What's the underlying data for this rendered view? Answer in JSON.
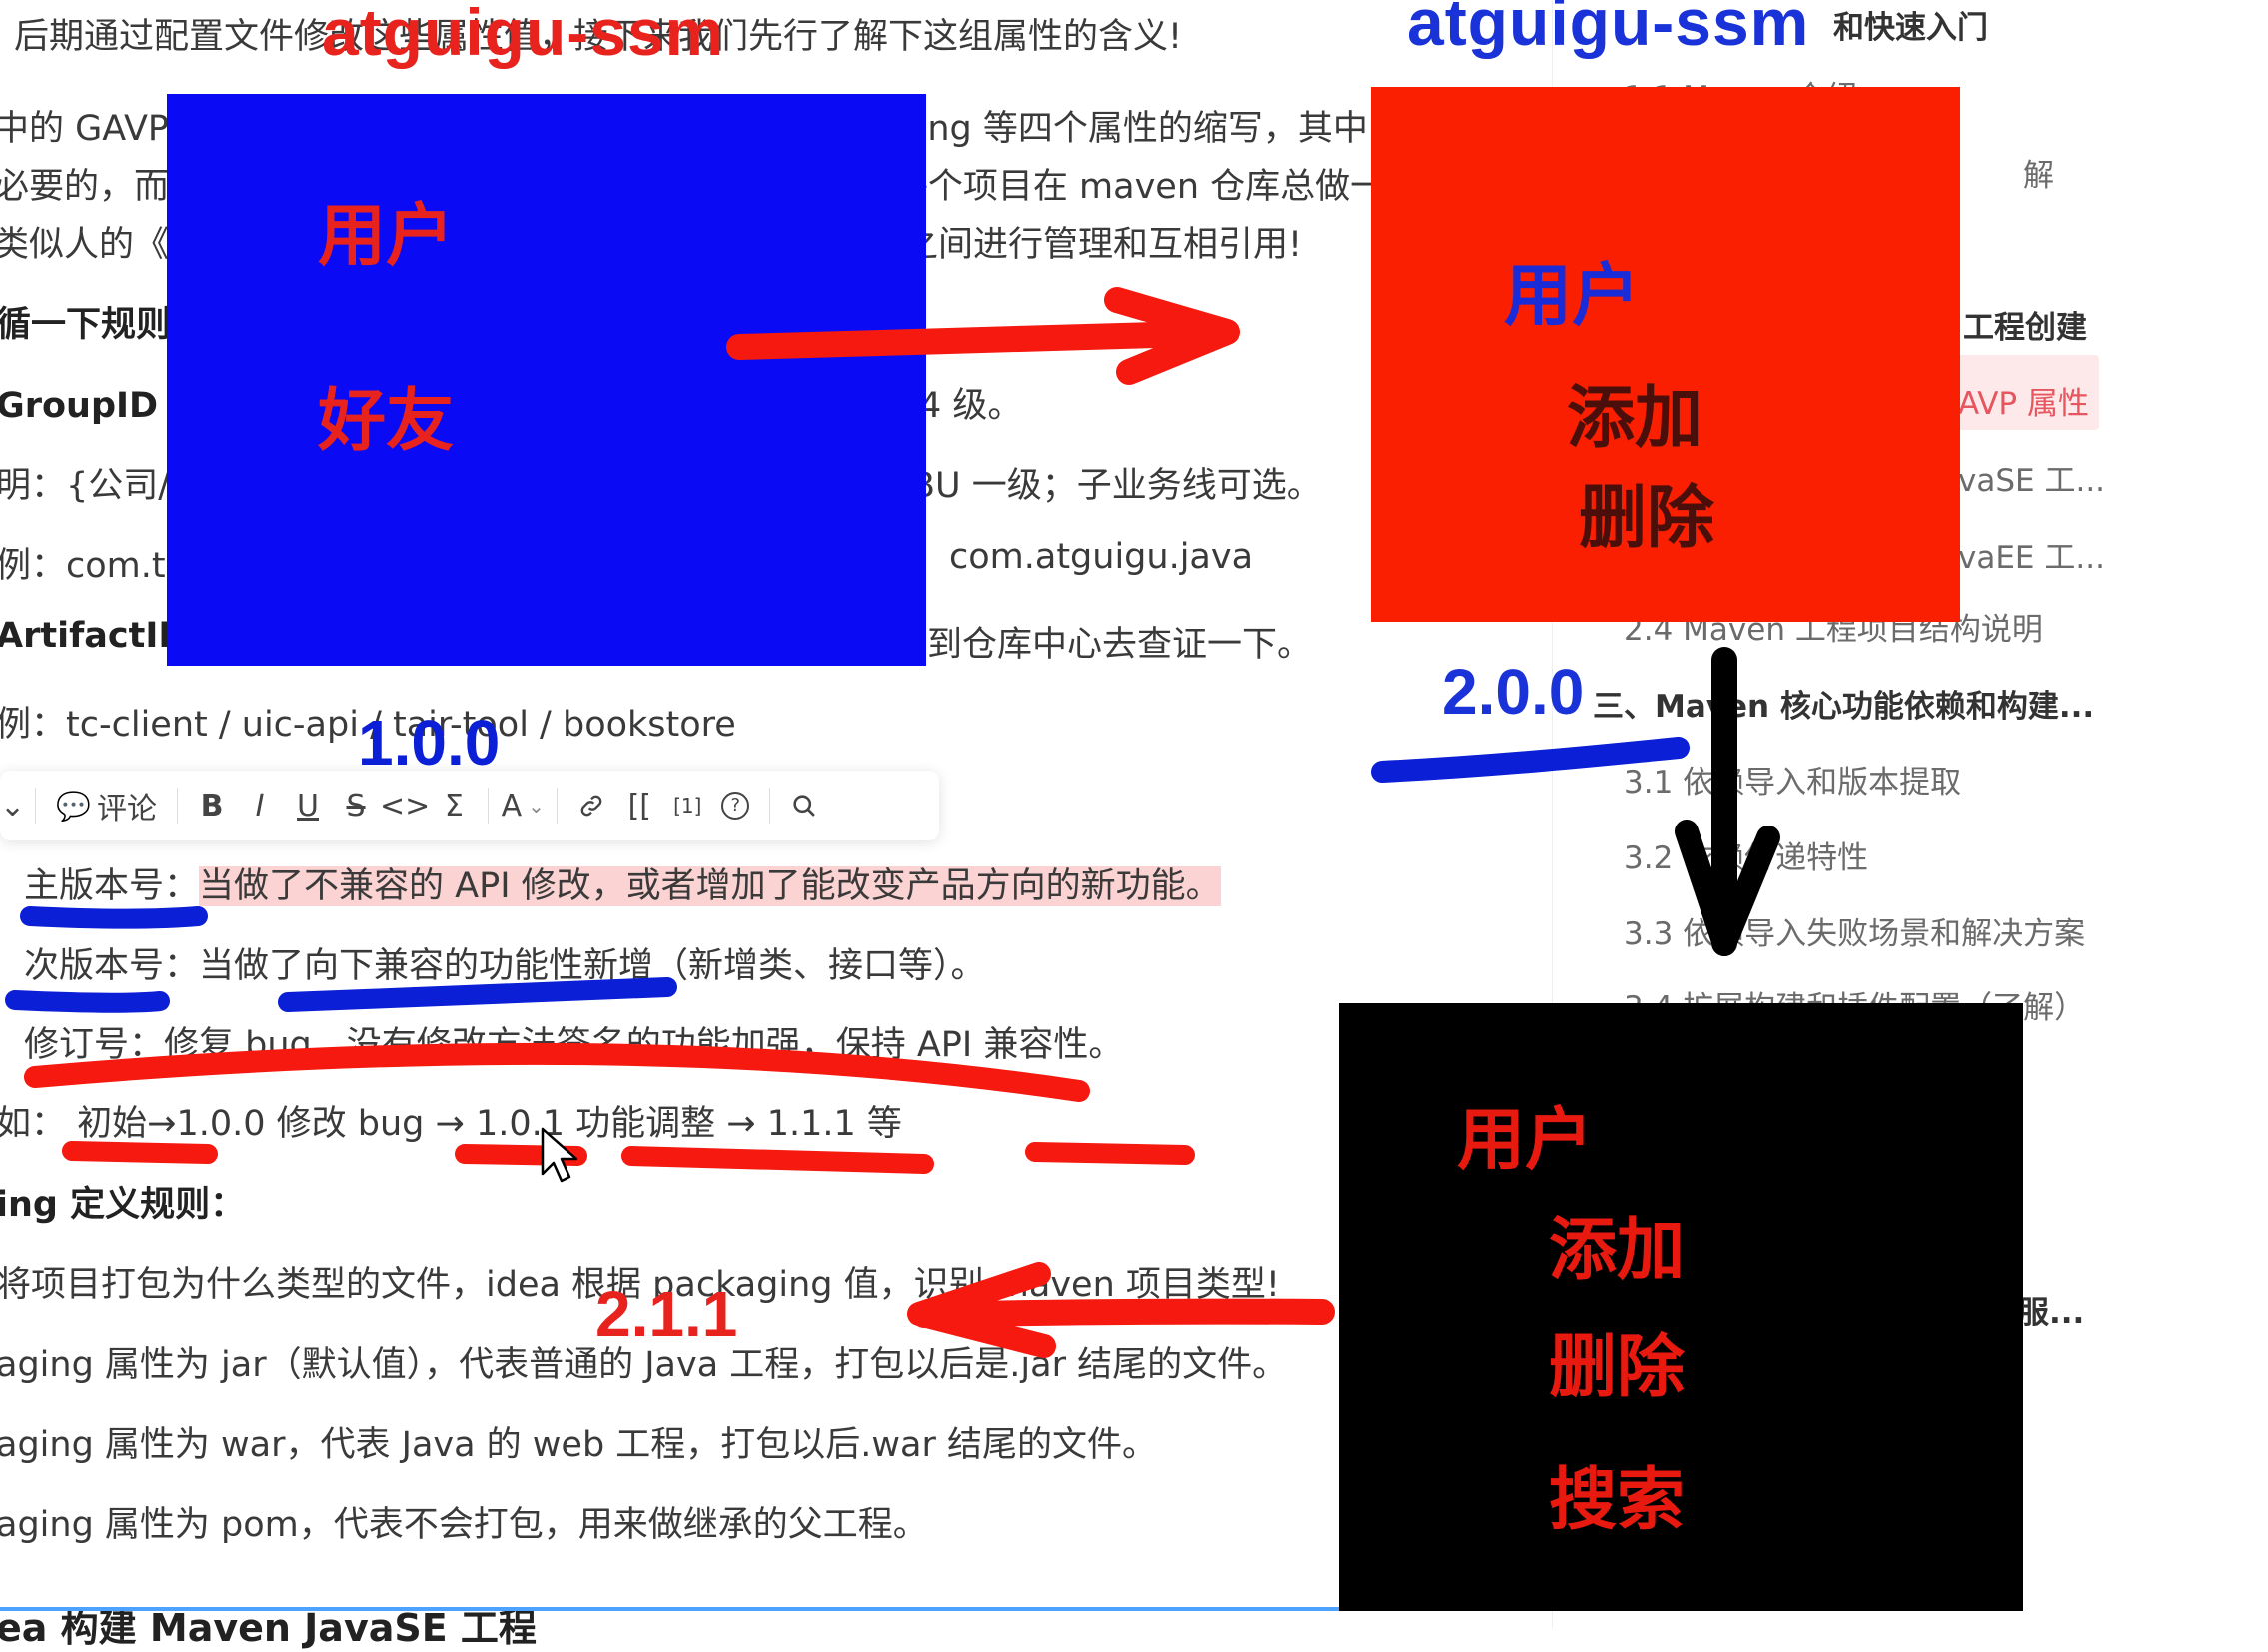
{
  "doc": {
    "top_line": "后期通过配置文件修改这些属性值，接下来我们先行了解下这组属性的含义!",
    "gavp_line1": "中的 GAVP 是指 GroupId、ArtifactId、Version、Packaging 等四个属性的缩写，其中",
    "gavp_line2": "必要的，而 Packaging 属性为可选项。这四个属性主要为每个项目在 maven 仓库总做一",
    "gavp_line3": "类似人的《姓名》一样，有了具体的坐标后，方便后期项目之间进行管理和互相引用!",
    "rule_title": "循一下规则：",
    "groupid_title": "GroupID 格式",
    "groupid_tail": "4 级。",
    "note_prefix": "明：{公司/",
    "note_tail": "BU 一级；子业务线可选。",
    "example_prefix": "例：com.ta",
    "example_tail": "com.atguigu.java",
    "artifact_title": "ArtifactID",
    "artifact_tail": "到仓库中心去查证一下。",
    "artifact_example": "例：tc-client / uic-api / tair-tool / bookstore",
    "major_label": "主版本号：",
    "major_text": "当做了不兼容的 API 修改，或者增加了能改变产品方向的新功能。",
    "minor_line": "次版本号：当做了向下兼容的功能性新增（新增类、接口等）。",
    "patch_line": "修订号：修复 bug，没有修改方法签名的功能加强，保持 API 兼容性。",
    "version_example": "如： 初始→1.0.0 修改 bug → 1.0.1 功能调整 → 1.1.1 等",
    "packaging_title": "ing 定义规则：",
    "packaging_line1": "将项目打包为什么类型的文件，idea 根据 packaging 值，识别 maven 项目类型!",
    "packaging_line2": "aging 属性为 jar（默认值），代表普通的 Java 工程，打包以后是.jar 结尾的文件。",
    "packaging_line3": "aging 属性为 war，代表 Java 的 web 工程，打包以后.war 结尾的文件。",
    "packaging_line4": "aging 属性为 pom，代表不会打包，用来做继承的父工程。",
    "bottom_heading": "ea 构建 Maven JavaSE 工程"
  },
  "toolbar": {
    "comment_label": "评论",
    "bold": "B",
    "italic": "I",
    "underline": "U",
    "strike": "S",
    "code": "<>",
    "formula": "Σ",
    "font_color": "A",
    "link_icon": "link-icon",
    "bracket": "[[",
    "footnote": "[1]",
    "help": "?",
    "search_icon": "search-icon"
  },
  "outline": {
    "header": "和快速入门",
    "item_1_1": "1.1 Maven 介绍",
    "item_fragment": "解",
    "item_project_create": "工程创建",
    "item_active": "AVP 属性",
    "item_javase": "vaSE 工...",
    "item_javaee": "vaEE 工...",
    "item_2_4": "2.4 Maven 工程项目结构说明",
    "section_3": "三、Maven 核心功能依赖和构建...",
    "item_3_1": "3.1 依赖导入和版本提取",
    "item_3_2": "3.2 依赖传递特性",
    "item_3_3": "3.3 依赖导入失败场景和解决方案",
    "item_3_4": "3.4 扩展构建和插件配置（了解）",
    "item_clipped": "服..."
  },
  "overlay": {
    "watermark_left": "atguigu-ssm",
    "watermark_right": "atguigu-ssm",
    "blue_box": {
      "line1": "用户",
      "line2": "好友"
    },
    "red_box": {
      "line1": "用户",
      "line2": "添加",
      "line3": "删除"
    },
    "black_box": {
      "line1": "用户",
      "line2": "添加",
      "line3": "删除",
      "line4": "搜索"
    },
    "version_blue": "1.0.0",
    "version_red_box": "2.0.0",
    "version_black_box": "2.1.1"
  },
  "colors": {
    "box_blue": "#0a0af5",
    "box_red": "#fa1f00",
    "box_black": "#000000",
    "annotation_red": "#f5190f",
    "annotation_blue": "#0b1fd6",
    "outline_active": "#e6565f"
  }
}
